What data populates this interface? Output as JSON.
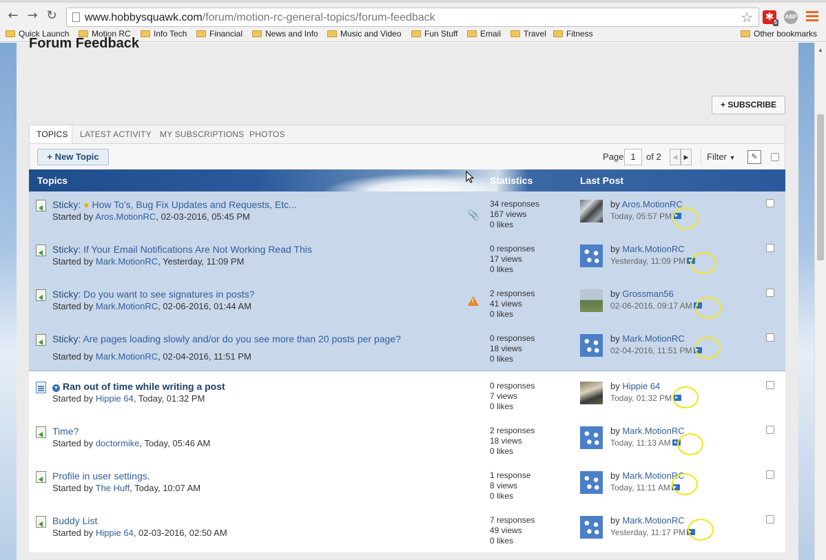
{
  "browser": {
    "url_host": "www.hobbysquawk.com",
    "url_path": "/forum/motion-rc-general-topics/forum-feedback",
    "ext_badge": "5",
    "abp_label": "ABP",
    "bookmarks": [
      "Quick Launch",
      "Motion RC",
      "Info Tech",
      "Financial",
      "News and Info",
      "Music and Video",
      "Fun Stuff",
      "Email",
      "Travel",
      "Fitness"
    ],
    "other_bookmarks": "Other bookmarks"
  },
  "page": {
    "title": "Forum Feedback",
    "subscribe_label": "+ SUBSCRIBE"
  },
  "tabs": [
    "TOPICS",
    "LATEST ACTIVITY",
    "MY SUBSCRIPTIONS",
    "PHOTOS"
  ],
  "toolbar": {
    "new_topic_label": "+ New Topic",
    "page_label": "Page",
    "page_value": "1",
    "of_label": "of 2",
    "filter_label": "Filter"
  },
  "columns": {
    "topics": "Topics",
    "statistics": "Statistics",
    "last_post": "Last Post"
  },
  "topics": [
    {
      "prefix": "Sticky: ",
      "title": "How To's, Bug Fix Updates and Requests, Etc...",
      "started_prefix": "Started by ",
      "starter": "Aros.MotionRC",
      "started_date": ", 02-03-2016, 05:45 PM",
      "responses": "34 responses",
      "views": "167 views",
      "likes": "0 likes",
      "by": "by ",
      "last_user": "Aros.MotionRC",
      "last_date": "Today, 05:57 PM"
    },
    {
      "prefix": "Sticky: ",
      "title": "If Your Email Notifications Are Not Working Read This",
      "started_prefix": "Started by ",
      "starter": "Mark.MotionRC",
      "started_date": ", Yesterday, 11:09 PM",
      "responses": "0 responses",
      "views": "17 views",
      "likes": "0 likes",
      "by": "by ",
      "last_user": "Mark.MotionRC",
      "last_date": "Yesterday, 11:09 PM"
    },
    {
      "prefix": "Sticky: ",
      "title": "Do you want to see signatures in posts?",
      "started_prefix": "Started by ",
      "starter": "Mark.MotionRC",
      "started_date": ", 02-06-2016, 01:44 AM",
      "responses": "2 responses",
      "views": "41 views",
      "likes": "0 likes",
      "by": "by ",
      "last_user": "Grossman56",
      "last_date": "02-06-2016, 09:17 AM"
    },
    {
      "prefix": "Sticky: ",
      "title": "Are pages loading slowly and/or do you see more than 20 posts per page?",
      "started_prefix": "Started by ",
      "starter": "Mark.MotionRC",
      "started_date": ", 02-04-2016, 11:51 PM",
      "responses": "0 responses",
      "views": "18 views",
      "likes": "0 likes",
      "by": "by ",
      "last_user": "Mark.MotionRC",
      "last_date": "02-04-2016, 11:51 PM"
    },
    {
      "prefix": "",
      "title": "Ran out of time while writing a post",
      "started_prefix": "Started by ",
      "starter": "Hippie 64",
      "started_date": ", Today, 01:32 PM",
      "responses": "0 responses",
      "views": "7 views",
      "likes": "0 likes",
      "by": "by ",
      "last_user": "Hippie 64",
      "last_date": "Today, 01:32 PM"
    },
    {
      "prefix": "",
      "title": "Time?",
      "started_prefix": "Started by ",
      "starter": "doctormike",
      "started_date": ", Today, 05:46 AM",
      "responses": "2 responses",
      "views": "18 views",
      "likes": "0 likes",
      "by": "by ",
      "last_user": "Mark.MotionRC",
      "last_date": "Today, 11:13 AM"
    },
    {
      "prefix": "",
      "title": "Profile in user settings.",
      "started_prefix": "Started by ",
      "starter": "The Huff",
      "started_date": ", Today, 10:07 AM",
      "responses": "1 response",
      "views": "8 views",
      "likes": "0 likes",
      "by": "by ",
      "last_user": "Mark.MotionRC",
      "last_date": "Today, 11:11 AM"
    },
    {
      "prefix": "",
      "title": "Buddy List",
      "started_prefix": "Started by ",
      "starter": "Hippie 64",
      "started_date": ", 02-03-2016, 02:50 AM",
      "responses": "7 responses",
      "views": "49 views",
      "likes": "0 likes",
      "by": "by ",
      "last_user": "Mark.MotionRC",
      "last_date": "Yesterday, 11:17 PM"
    }
  ]
}
